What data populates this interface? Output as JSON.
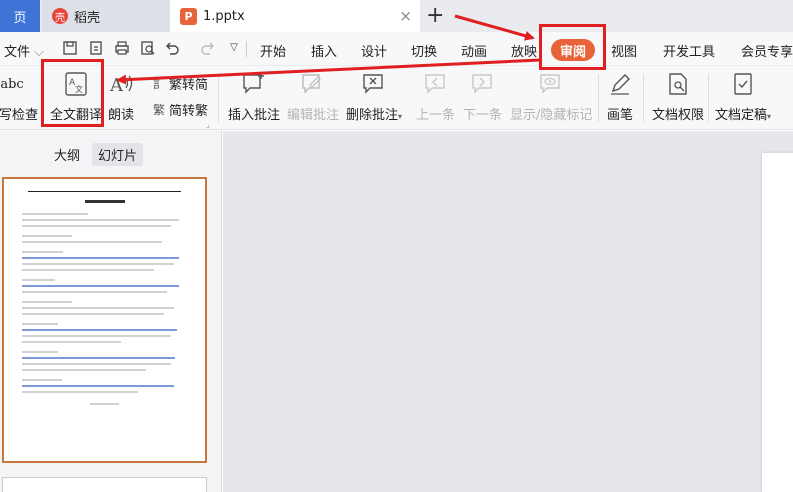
{
  "tabs": {
    "home": "页",
    "docer": "稻壳",
    "docer_logo": "壳",
    "file": "1.pptx",
    "file_logo": "P",
    "close": "×",
    "add": "+"
  },
  "menu": {
    "file": "文件",
    "items": [
      "开始",
      "插入",
      "设计",
      "切换",
      "动画",
      "放映",
      "审阅",
      "视图",
      "开发工具",
      "会员专享"
    ]
  },
  "ribbon": {
    "spellcheck": "拼写检查",
    "spellcheck_icon_text": "abc",
    "translate": "全文翻译",
    "read_aloud": "朗读",
    "trad_to_simp": "繁转简",
    "simp_to_trad": "简转繁",
    "insert_comment": "插入批注",
    "edit_comment": "编辑批注",
    "delete_comment": "删除批注",
    "prev": "上一条",
    "next": "下一条",
    "toggle_marks": "显示/隐藏标记",
    "pen": "画笔",
    "doc_permission": "文档权限",
    "doc_finalize": "文档定稿"
  },
  "pane": {
    "outline": "大纲",
    "slides": "幻灯片"
  },
  "colors": {
    "accent": "#e8623a",
    "highlight": "#e02020",
    "tab_home": "#3f73d6"
  }
}
